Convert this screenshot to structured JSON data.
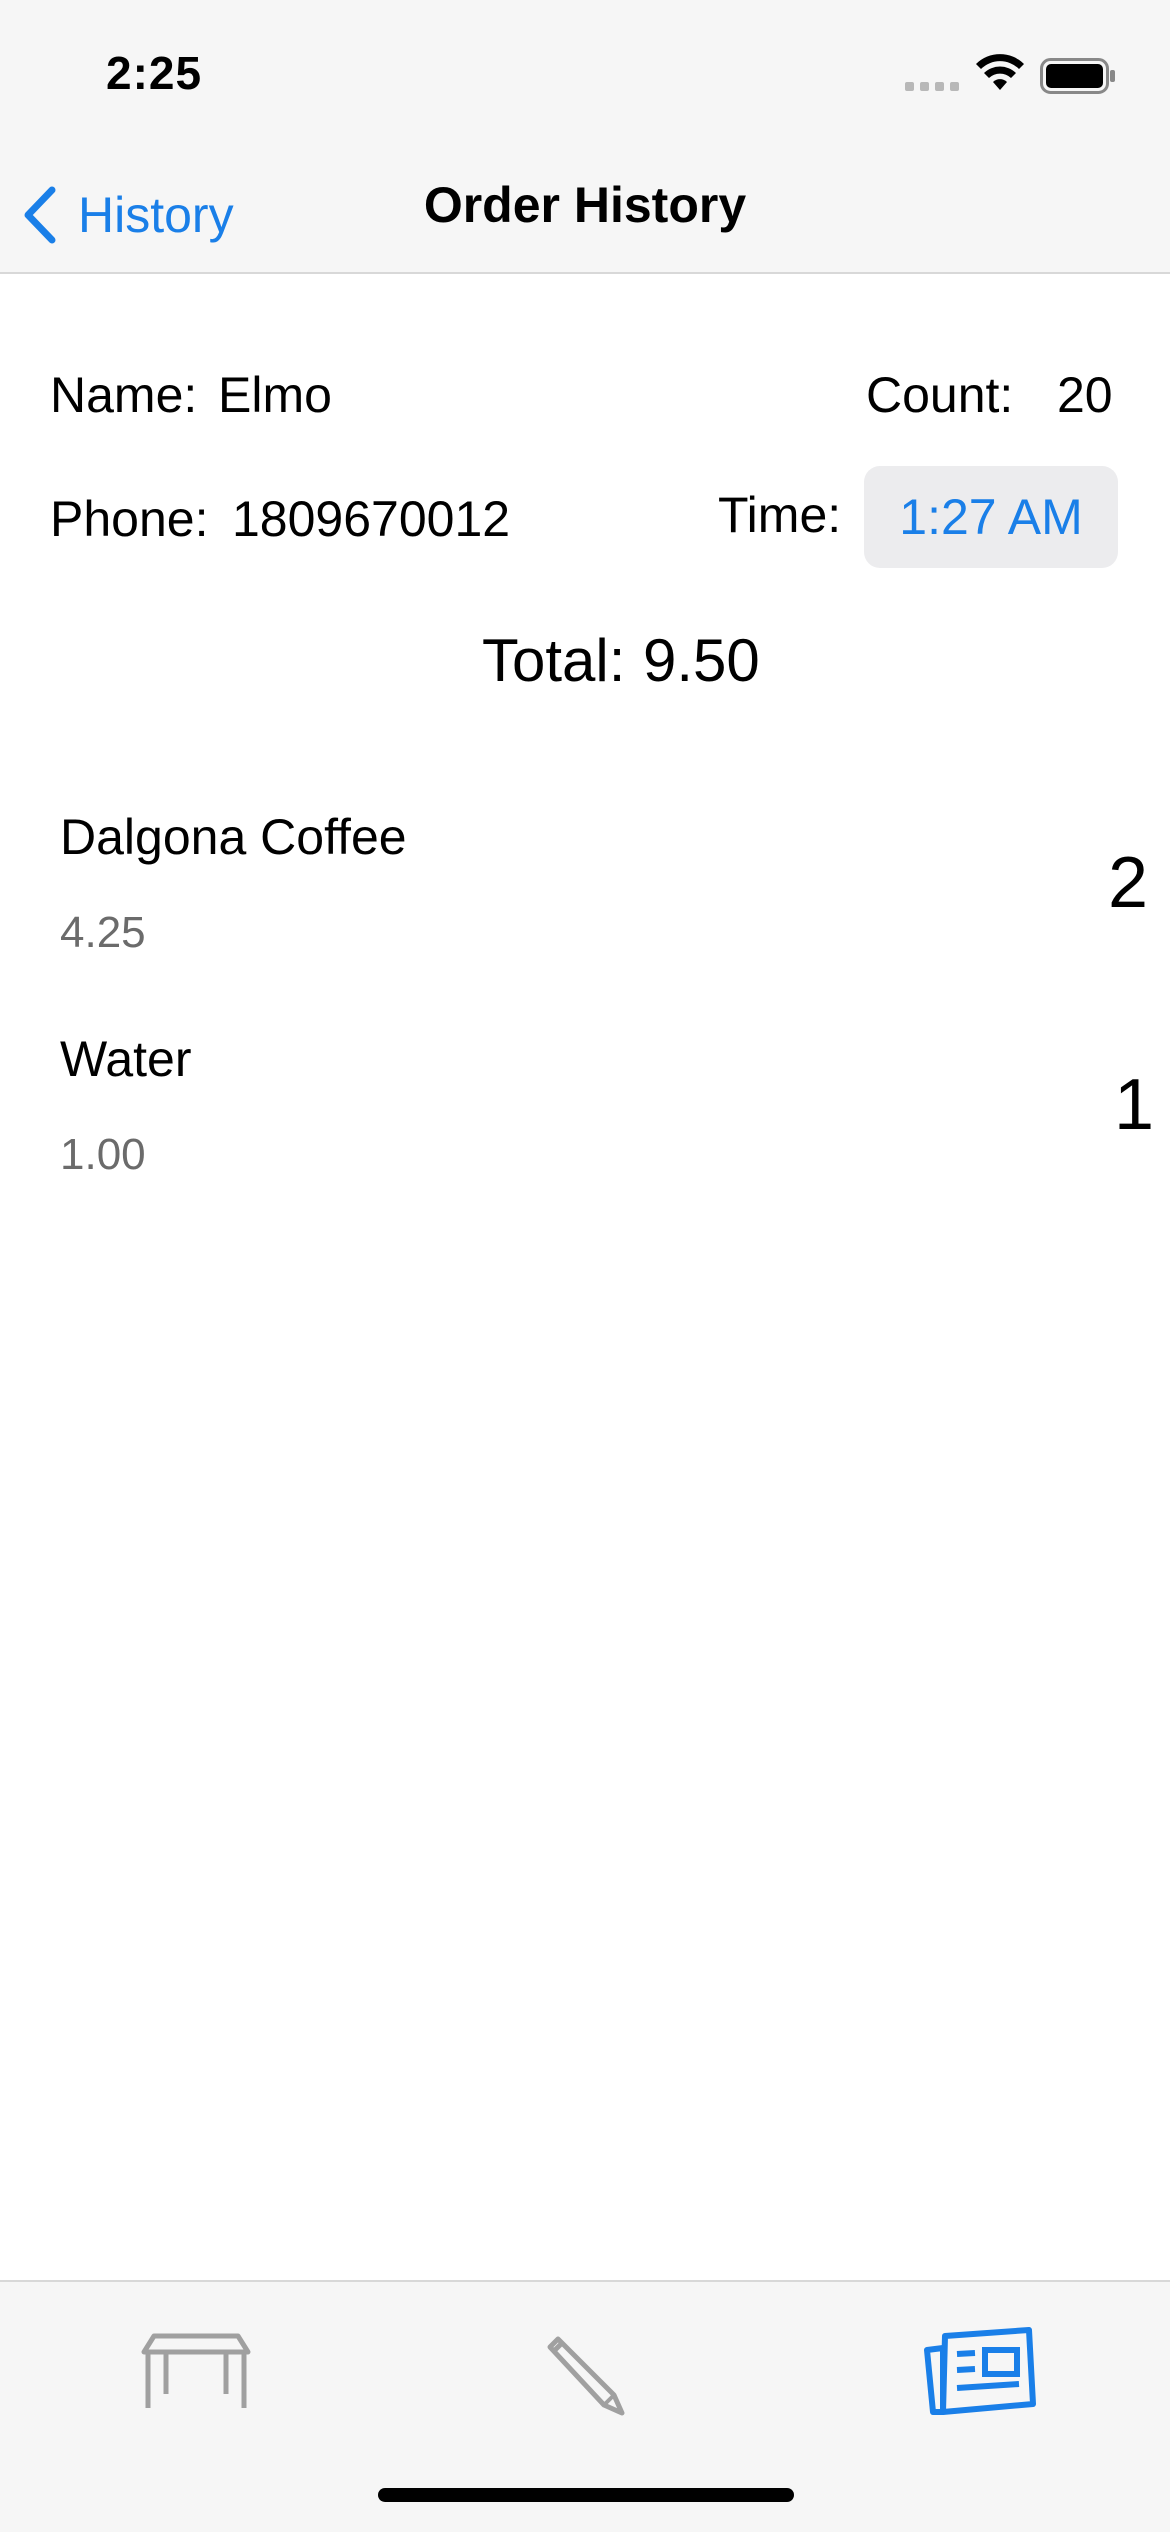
{
  "status_bar": {
    "time": "2:25"
  },
  "nav": {
    "back_label": "History",
    "title": "Order History"
  },
  "order": {
    "name_label": "Name:",
    "name_value": "Elmo",
    "count_label": "Count:",
    "count_value": "20",
    "phone_label": "Phone:",
    "phone_value": "1809670012",
    "time_label": "Time:",
    "time_value": "1:27 AM",
    "total_label": "Total:",
    "total_value": "9.50"
  },
  "items": [
    {
      "name": "Dalgona Coffee",
      "price": "4.25",
      "qty": "2"
    },
    {
      "name": "Water",
      "price": "1.00",
      "qty": "1"
    }
  ],
  "tab_bar": {
    "tabs": [
      {
        "icon": "table-icon",
        "selected": false
      },
      {
        "icon": "pencil-icon",
        "selected": false
      },
      {
        "icon": "newspaper-icon",
        "selected": true
      }
    ]
  },
  "colors": {
    "accent": "#1a7fe8",
    "inactive": "#a0a0a0",
    "bar_bg": "#f6f6f6"
  }
}
